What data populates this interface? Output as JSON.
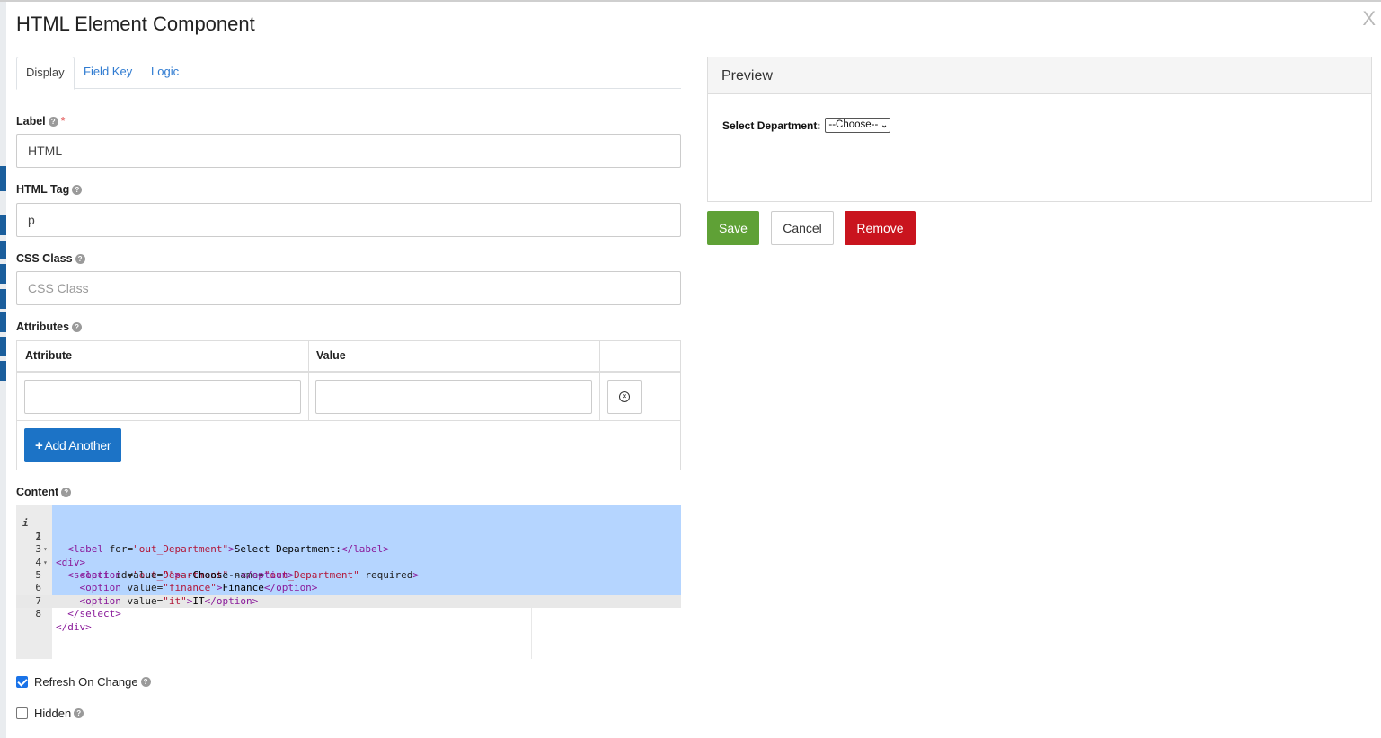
{
  "modal": {
    "title": "HTML Element Component",
    "close_label": "X"
  },
  "tabs": [
    {
      "label": "Display",
      "active": true
    },
    {
      "label": "Field Key",
      "active": false
    },
    {
      "label": "Logic",
      "active": false
    }
  ],
  "fields": {
    "label": {
      "label": "Label",
      "required_mark": "*",
      "value": "HTML"
    },
    "html_tag": {
      "label": "HTML Tag",
      "value": "p"
    },
    "css_class": {
      "label": "CSS Class",
      "placeholder": "CSS Class",
      "value": ""
    },
    "attributes": {
      "label": "Attributes",
      "columns": [
        "Attribute",
        "Value"
      ],
      "rows": [
        {
          "attribute": "",
          "value": ""
        }
      ],
      "add_label": "Add Another"
    },
    "content": {
      "label": "Content",
      "line_numbers": [
        "1",
        "2",
        "3",
        "4",
        "5",
        "6",
        "7",
        "8"
      ]
    },
    "refresh_on_change": {
      "label": "Refresh On Change",
      "checked": true
    },
    "hidden": {
      "label": "Hidden",
      "checked": false
    }
  },
  "preview": {
    "title": "Preview",
    "select_label": "Select Department:",
    "select_value": "--Choose--"
  },
  "actions": {
    "save": "Save",
    "cancel": "Cancel",
    "remove": "Remove"
  },
  "colors": {
    "save": "#5fa136",
    "remove": "#c9141e",
    "primary": "#1c73c6",
    "link": "#2f7bd1",
    "selection": "#b5d5ff"
  }
}
